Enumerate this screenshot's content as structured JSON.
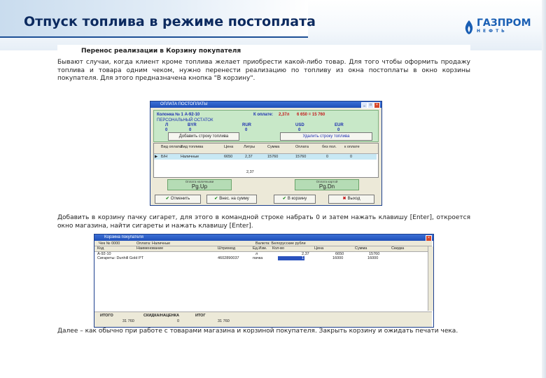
{
  "slide": {
    "title": "Отпуск топлива в режиме постоплата",
    "logo": {
      "name": "ГАЗПРОМ",
      "sub": "НЕФТЬ"
    }
  },
  "instructions": {
    "heading": "Перенос реализации в Корзину покупателя",
    "para1": "Бывают случаи, когда клиент кроме топлива желает приобрести какой-либо товар. Для того чтобы оформить продажу топлива и товара одним чеком, нужно перенести реализацию по топливу из окна постоплаты в окно корзины покупателя. Для этого предназначена кнопка \"В корзину\".",
    "para2": "Добавить в корзину пачку сигарет, для этого в командной строке набрать 0 и затем нажать клавишу [Enter], откроется окно магазина, найти сигареты и нажать клавишу [Enter].",
    "para3": "Далее – как обычно при работе с товарами магазина и корзиной покупателя. Закрыть корзину и ожидать печати чека."
  },
  "postpay_window": {
    "title": "ОПЛАТА ПОСТОПЛАТЫ",
    "column_label": "Колонка № 1 А-92-10",
    "to_pay_label": "К оплате:",
    "to_pay_value": "2,37л",
    "to_pay_calc": "6 650 = 15 760",
    "remainder_label": "ПЕРСОНАЛЬНЫЙ ОСТАТОК",
    "currencies": [
      {
        "code": "Л",
        "val": "0"
      },
      {
        "code": "BYR",
        "val": "0"
      },
      {
        "code": "RUR",
        "val": "0"
      },
      {
        "code": "USD",
        "val": "0"
      },
      {
        "code": "EUR",
        "val": "0"
      }
    ],
    "add_row_btn": "Добавить строку топлива",
    "delete_row_btn": "Удалить строку топлива",
    "table": {
      "headers": [
        "Вид оплаты",
        "Вид топлива",
        "Цена",
        "Литры",
        "Сумма",
        "Оплата",
        "без пол.",
        "к оплате"
      ],
      "rows": [
        [
          "Б/Н",
          "Наличные",
          "6650",
          "2,37",
          "15760",
          "15760",
          "0",
          "0"
        ]
      ],
      "footer_liters": "2,37"
    },
    "pay_left": {
      "label": "Оплата наличными",
      "value": "Pg.Up"
    },
    "pay_right": {
      "label": "Оплата картой",
      "value": "Pg.Dn"
    },
    "buttons": {
      "ok": "Отменить",
      "pay_all": "Внес. на сумму",
      "to_cart": "В корзину",
      "exit": "Выход"
    }
  },
  "cart_window": {
    "title": "Корзина покупателя",
    "toolbar": {
      "doc": "Чек № 0000",
      "payment_mode": "Оплата: Наличные",
      "currency_mode": "Валюта: Белорусские рубли"
    },
    "headers": [
      "Код",
      "Наименование",
      "Штрихкод",
      "Ед.Изм.",
      "Кол-во",
      "Цена",
      "Сумма",
      "Скидка"
    ],
    "rows": [
      [
        "А-92-10",
        "",
        "",
        "л",
        "2,37",
        "6650",
        "15760",
        ""
      ],
      [
        "Сигареты: Dunhill Gold PT",
        "",
        "4602890037",
        "пачка",
        "1",
        "16000",
        "16000",
        ""
      ]
    ],
    "footer": {
      "total_label": "ИТОГО",
      "total_value": "31 760",
      "discount_label": "СКИДКА/НАЦЕНКА",
      "discount_value": "0",
      "grand_label": "ИТОГ",
      "grand_value": "31 760"
    }
  }
}
